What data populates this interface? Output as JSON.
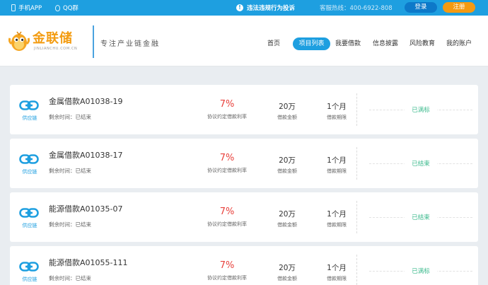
{
  "topbar": {
    "app_label": "手机APP",
    "qq_label": "QQ群",
    "report_label": "违法违规行为投诉",
    "hotline": "客服热线：400-6922-808",
    "login_label": "登录",
    "register_label": "注册"
  },
  "header": {
    "brand": "金联储",
    "brand_sub": "JINLIANCHU.COM.CN",
    "slogan": "专注产业链金融",
    "nav": [
      {
        "label": "首页"
      },
      {
        "label": "项目列表",
        "active": true
      },
      {
        "label": "我要借款"
      },
      {
        "label": "信息披露"
      },
      {
        "label": "风险教育"
      },
      {
        "label": "我的账户"
      }
    ]
  },
  "labels": {
    "rate": "协议约定借款利率",
    "amount": "借款金额",
    "term": "借款期限"
  },
  "loans": [
    {
      "category": "供应链",
      "title": "金属借款A01038-19",
      "remaining": "剩余时间：已结束",
      "rate": "7%",
      "amount": "20万",
      "term": "1个月",
      "status": "已满标"
    },
    {
      "category": "供应链",
      "title": "金属借款A01038-17",
      "remaining": "剩余时间：已结束",
      "rate": "7%",
      "amount": "20万",
      "term": "1个月",
      "status": "已结束"
    },
    {
      "category": "供应链",
      "title": "能源借款A01035-07",
      "remaining": "剩余时间：已结束",
      "rate": "7%",
      "amount": "20万",
      "term": "1个月",
      "status": "已结束"
    },
    {
      "category": "供应链",
      "title": "能源借款A01055-111",
      "remaining": "剩余时间：已结束",
      "rate": "7%",
      "amount": "20万",
      "term": "1个月",
      "status": "已满标"
    }
  ],
  "colors": {
    "primary": "#1e9fe0",
    "accent": "#f59a12",
    "rate": "#e8413c",
    "status": "#3cba8d"
  },
  "icons": {
    "app": "phone-icon",
    "qq": "qq-icon",
    "report": "alert-icon",
    "category": "chain-link-icon",
    "logo": "mascot-icon"
  }
}
